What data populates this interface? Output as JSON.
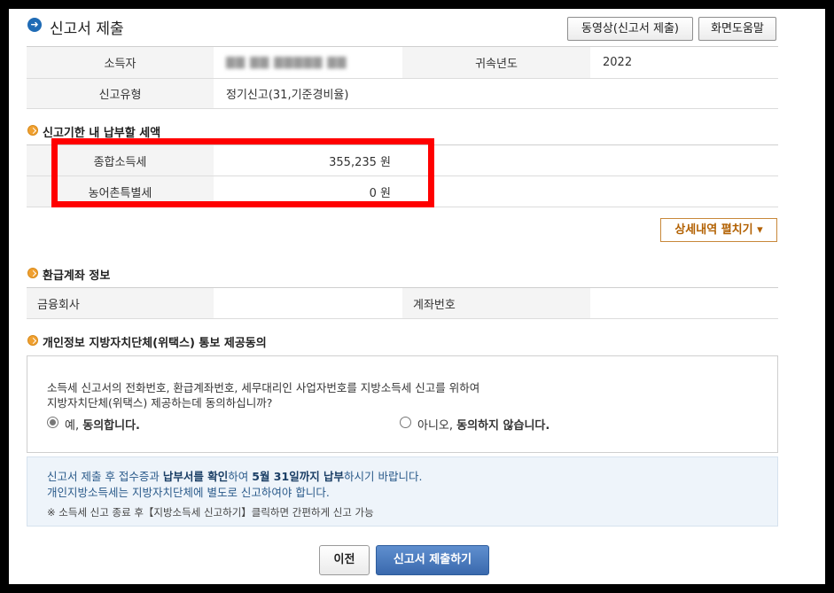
{
  "header": {
    "title": "신고서 제출",
    "title_icon": "arrow-right-circle-icon",
    "video_button": "동영상(신고서 제출)",
    "help_button": "화면도움말"
  },
  "info": {
    "taxpayer_label": "소득자",
    "taxpayer_value": "▇▇ ▇▇ ▇▇▇▇▇ ▇▇",
    "year_label": "귀속년도",
    "year_value": "2022",
    "type_label": "신고유형",
    "type_value": "정기신고(31,기준경비율)"
  },
  "tax_section": {
    "title": "신고기한 내 납부할 세액",
    "rows": [
      {
        "label": "종합소득세",
        "value": "355,235 원"
      },
      {
        "label": "농어촌특별세",
        "value": "0 원"
      }
    ],
    "detail_button": "상세내역 펼치기 ▾"
  },
  "refund": {
    "title": "환급계좌 정보",
    "bank_label": "금융회사",
    "bank_value": "",
    "account_label": "계좌번호",
    "account_value": ""
  },
  "consent": {
    "title": "개인정보 지방자치단체(위택스) 통보 제공동의",
    "question_line1": "소득세 신고서의 전화번호, 환급계좌번호, 세무대리인 사업자번호를 지방소득세 신고를 위하여",
    "question_line2": "지방자치단체(위택스) 제공하는데 동의하십니까?",
    "yes_prefix": "예, ",
    "yes_bold": "동의합니다.",
    "no_prefix": "아니오, ",
    "no_bold": "동의하지 않습니다.",
    "selected": "yes"
  },
  "notice": {
    "line1_a": "신고서 제출 후 접수증과 ",
    "line1_b": "납부서를 확인",
    "line1_c": "하여 ",
    "line1_d": "5월 31일까지 납부",
    "line1_e": "하시기 바랍니다.",
    "line2": "개인지방소득세는 지방자치단체에 별도로 신고하여야 합니다.",
    "line3": "※ 소득세 신고 종료 후【지방소득세 신고하기】클릭하면 간편하게 신고 가능"
  },
  "footer": {
    "prev_button": "이전",
    "submit_button": "신고서 제출하기"
  },
  "colors": {
    "highlight_box": "#ff0000",
    "submit_button": "#3a69ad",
    "section_icon": "#f0a030"
  }
}
